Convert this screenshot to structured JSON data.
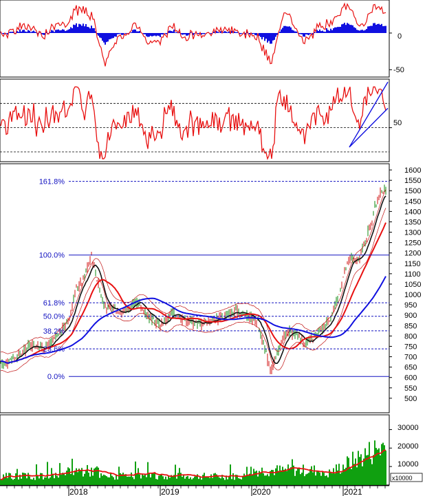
{
  "chart_data": [
    {
      "type": "line",
      "panel": "oscillator",
      "title": "",
      "ylabel": "",
      "ylim": [
        -60,
        45
      ],
      "yticks": [
        "0",
        "-50"
      ],
      "yticks_values": [
        0,
        -50
      ],
      "series": [],
      "colors": {
        "line": "#e81010",
        "histogram": "#1010e0"
      }
    },
    {
      "type": "line",
      "panel": "rsi",
      "title": "",
      "ylim": [
        15,
        100
      ],
      "yticks": [
        "50"
      ],
      "yticks_values": [
        50
      ],
      "reference_levels": [
        75,
        50,
        25
      ],
      "colors": {
        "line": "#e81010",
        "trendline": "#1010e0"
      }
    },
    {
      "type": "line",
      "panel": "price",
      "title": "",
      "ylim": [
        430,
        1630
      ],
      "yticks": [
        "1600",
        "1550",
        "1500",
        "1450",
        "1400",
        "1350",
        "1300",
        "1250",
        "1200",
        "1150",
        "1100",
        "1050",
        "1000",
        "950",
        "900",
        "850",
        "800",
        "750",
        "700",
        "650",
        "600",
        "550",
        "500"
      ],
      "fibonacci_levels": [
        {
          "label": "161.8%",
          "value": 1545
        },
        {
          "label": "100.0%",
          "value": 1190
        },
        {
          "label": "61.8%",
          "value": 960
        },
        {
          "label": "50.0%",
          "value": 895
        },
        {
          "label": "38.2%",
          "value": 825
        },
        {
          "label": "23.6%",
          "value": 738
        },
        {
          "label": "0.0%",
          "value": 605
        }
      ],
      "colors": {
        "candles": "#0f8a0f",
        "fast_ma": "#111111",
        "mid_ma": "#e81010",
        "slow_ma": "#1010e0",
        "bands": "#c01010",
        "fib": "#1010c0"
      }
    },
    {
      "type": "bar",
      "panel": "volume",
      "title": "",
      "ylim": [
        0,
        38000
      ],
      "yticks": [
        "30000",
        "20000",
        "10000"
      ],
      "yticks_values": [
        30000,
        20000,
        10000
      ],
      "unit_label": "x10000",
      "colors": {
        "bars": "#10a010",
        "ma": "#e81010"
      }
    }
  ],
  "x_axis": {
    "labels": [
      "2018",
      "2019",
      "2020",
      "2021"
    ]
  }
}
